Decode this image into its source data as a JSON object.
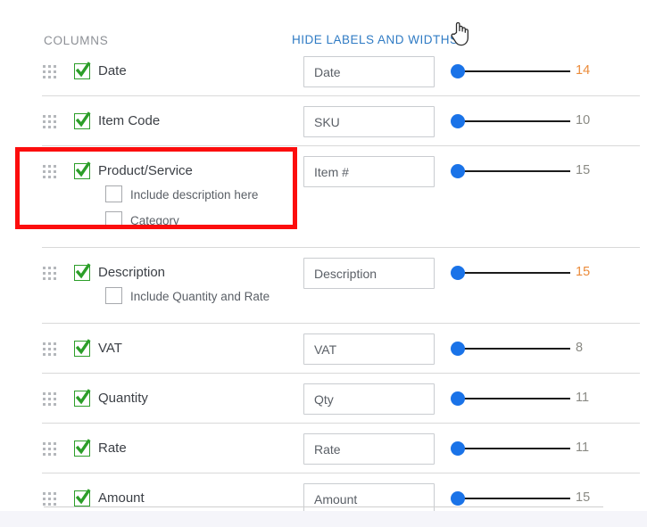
{
  "header": {
    "columns_title": "COLUMNS",
    "hide_link": "HIDE LABELS AND WIDTHS",
    "cursor": "pointing-hand-cursor"
  },
  "colors": {
    "link": "#2f7bc4",
    "check_green": "#2c9e29",
    "slider_blue": "#1a73e8",
    "value_gray": "#8a8a84",
    "value_orange": "#eb8b3a",
    "annotation_red": "#fc0d0d"
  },
  "rows": [
    {
      "label": "Date",
      "checked": true,
      "input_value": "Date",
      "width_value": "14",
      "width_highlight": true,
      "sub_options": []
    },
    {
      "label": "Item Code",
      "checked": true,
      "input_value": "SKU",
      "width_value": "10",
      "width_highlight": false,
      "sub_options": []
    },
    {
      "label": "Product/Service",
      "checked": true,
      "input_value": "Item #",
      "width_value": "15",
      "width_highlight": false,
      "sub_options": [
        {
          "label": "Include description here",
          "checked": false
        },
        {
          "label": "Category",
          "checked": false
        }
      ]
    },
    {
      "label": "Description",
      "checked": true,
      "input_value": "Description",
      "width_value": "15",
      "width_highlight": true,
      "sub_options": [
        {
          "label": "Include Quantity and Rate",
          "checked": false
        }
      ]
    },
    {
      "label": "VAT",
      "checked": true,
      "input_value": "VAT",
      "width_value": "8",
      "width_highlight": false,
      "sub_options": []
    },
    {
      "label": "Quantity",
      "checked": true,
      "input_value": "Qty",
      "width_value": "11",
      "width_highlight": false,
      "sub_options": []
    },
    {
      "label": "Rate",
      "checked": true,
      "input_value": "Rate",
      "width_value": "11",
      "width_highlight": false,
      "sub_options": []
    },
    {
      "label": "Amount",
      "checked": true,
      "input_value": "Amount",
      "width_value": "15",
      "width_highlight": false,
      "sub_options": []
    }
  ],
  "annotation": {
    "target_row_label": "Product/Service",
    "shape": "red-rectangle-highlight"
  }
}
